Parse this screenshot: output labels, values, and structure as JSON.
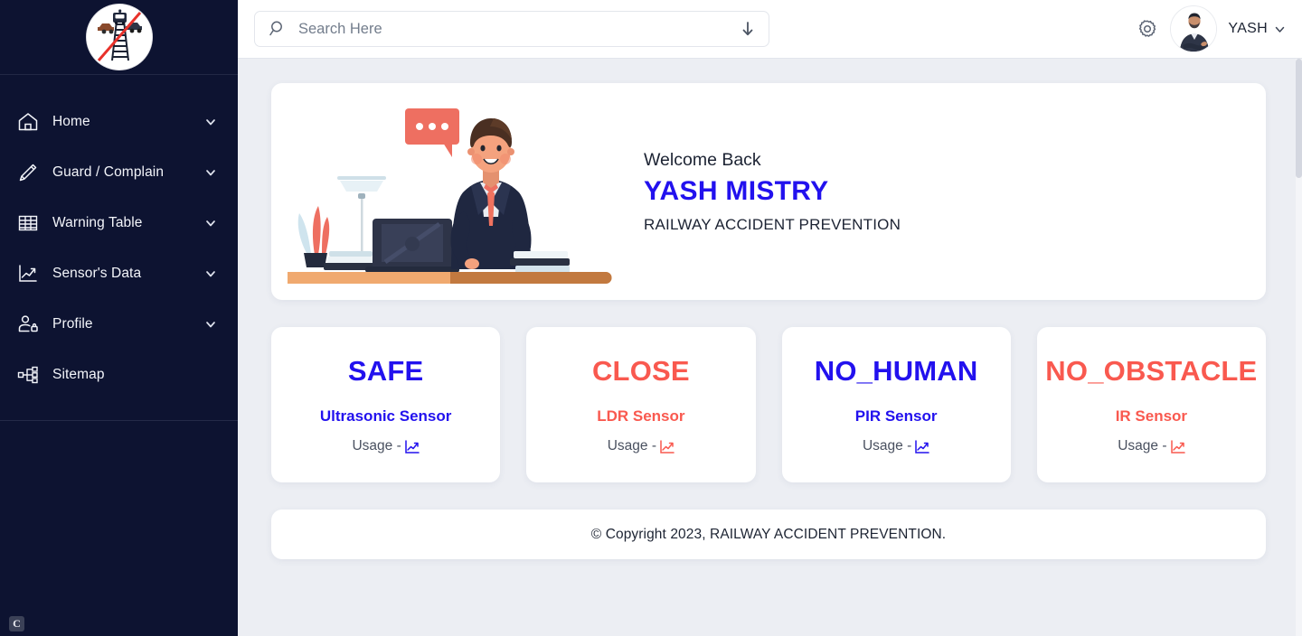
{
  "brand": {
    "logo_icon": "railway-crossing-no-entry-logo",
    "corner_badge": "C"
  },
  "colors": {
    "sidebar_bg": "#0d1331",
    "content_bg": "#eceef3",
    "accent_blue": "#2211ee",
    "accent_red": "#f9594f",
    "text_dark": "#1d2433"
  },
  "sidebar": {
    "items": [
      {
        "label": "Home",
        "icon": "home-icon",
        "expandable": true
      },
      {
        "label": "Guard / Complain",
        "icon": "pencil-icon",
        "expandable": true
      },
      {
        "label": "Warning Table",
        "icon": "table-grid-icon",
        "expandable": true
      },
      {
        "label": "Sensor's Data",
        "icon": "line-chart-icon",
        "expandable": true
      },
      {
        "label": "Profile",
        "icon": "user-lock-icon",
        "expandable": true
      },
      {
        "label": "Sitemap",
        "icon": "sitemap-icon",
        "expandable": false
      }
    ]
  },
  "header": {
    "search": {
      "placeholder": "Search Here",
      "value": "",
      "icon": "search-icon",
      "trailing_icon": "arrow-down-icon"
    },
    "settings_icon": "gear-icon",
    "user": {
      "name": "YASH",
      "avatar_icon": "user-avatar-photo",
      "chevron_icon": "chevron-down-icon"
    }
  },
  "welcome": {
    "greeting": "Welcome Back",
    "user_name": "YASH MISTRY",
    "subtitle": "RAILWAY ACCIDENT PREVENTION",
    "illustration_icon": "businessman-at-desk-illustration"
  },
  "sensors": [
    {
      "status": "SAFE",
      "name": "Ultrasonic Sensor",
      "usage_label": "Usage -",
      "usage_icon": "line-chart-icon",
      "color": "#2211ee"
    },
    {
      "status": "CLOSE",
      "name": "LDR Sensor",
      "usage_label": "Usage -",
      "usage_icon": "line-chart-icon",
      "color": "#f9594f"
    },
    {
      "status": "NO_HUMAN",
      "name": "PIR Sensor",
      "usage_label": "Usage -",
      "usage_icon": "line-chart-icon",
      "color": "#2211ee"
    },
    {
      "status": "NO_OBSTACLE",
      "name": "IR Sensor",
      "usage_label": "Usage -",
      "usage_icon": "line-chart-icon",
      "color": "#f9594f"
    }
  ],
  "footer": {
    "copyright": "© Copyright 2023, RAILWAY ACCIDENT PREVENTION."
  }
}
